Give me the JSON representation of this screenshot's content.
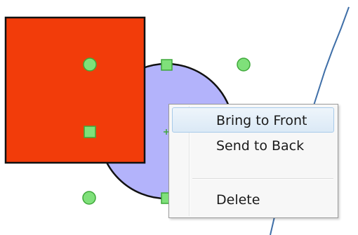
{
  "context_menu": {
    "items": [
      {
        "label": "Bring to Front",
        "highlighted": true
      },
      {
        "label": "Send to Back",
        "highlighted": false
      },
      {
        "label": "Delete",
        "highlighted": false
      }
    ]
  },
  "colors": {
    "rectangle_fill": "#f23c0a",
    "circle_fill": "#b3b3fb",
    "shape_stroke": "#111111",
    "handle_fill": "#7fe07a",
    "handle_stroke": "#3fa83a",
    "connector_line": "#3f6fa8",
    "menu_highlight": "#dbe9f6"
  },
  "icons": {
    "round_handle": "round-resize-handle",
    "square_handle": "square-resize-handle"
  }
}
